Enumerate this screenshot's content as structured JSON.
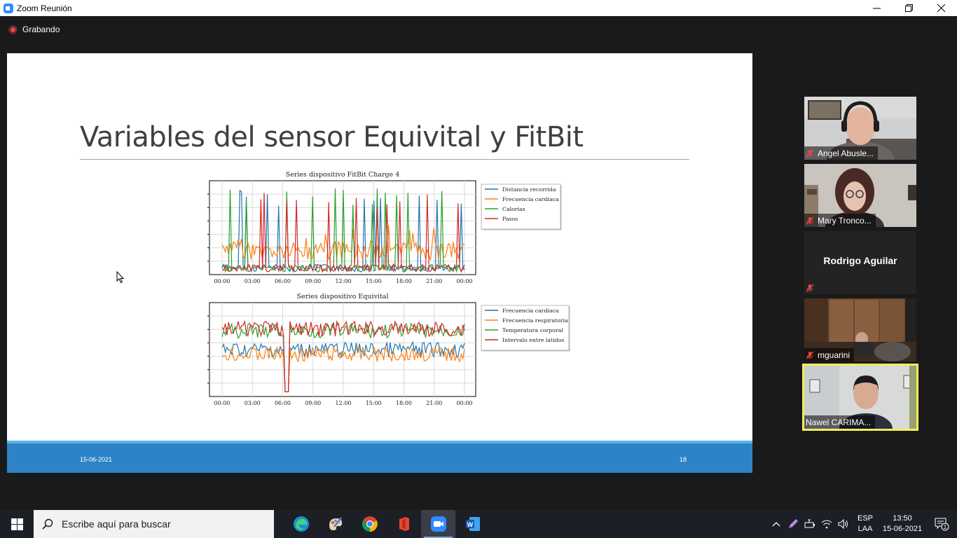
{
  "window": {
    "title": "Zoom Reunión",
    "controls": [
      "minimize",
      "restore",
      "close"
    ]
  },
  "recording": {
    "label": "Grabando"
  },
  "slide": {
    "title": "Variables del sensor Equivital y FitBit",
    "footer_date": "15-06-2021",
    "page_number": "18"
  },
  "participants": [
    {
      "name": "Angel Abusle...",
      "muted": true,
      "video": true
    },
    {
      "name": "Mary Tronco...",
      "muted": true,
      "video": true
    },
    {
      "name": "Rodrigo Aguilar",
      "muted": true,
      "video": false
    },
    {
      "name": "mguarini",
      "muted": true,
      "video": true
    },
    {
      "name": "Nawel CARIMA...",
      "muted": false,
      "video": true,
      "active_speaker": true
    }
  ],
  "taskbar": {
    "search_placeholder": "Escribe aquí para buscar",
    "apps": [
      "edge-icon",
      "paint-icon",
      "chrome-icon",
      "office-icon",
      "zoom-icon",
      "word-icon"
    ],
    "active_app": "zoom-icon",
    "lang_line1": "ESP",
    "lang_line2": "LAA",
    "time": "13:50",
    "date": "15-06-2021",
    "notifications": "1"
  },
  "chart_data": [
    {
      "type": "line",
      "title": "Series dispositivo FitBit Charge 4",
      "xticks": [
        "00:00",
        "03:00",
        "06:00",
        "09:00",
        "12:00",
        "15:00",
        "18:00",
        "21:00",
        "00:00"
      ],
      "legend_position": "outside-right-top",
      "grid": true,
      "series": [
        {
          "name": "Distancia recorrida",
          "color": "#1f77b4"
        },
        {
          "name": "Frecuencia cardíaca",
          "color": "#ff7f0e"
        },
        {
          "name": "Calorías",
          "color": "#2ca02c"
        },
        {
          "name": "Pasos",
          "color": "#d62728"
        }
      ]
    },
    {
      "type": "line",
      "title": "Series dispositivo Equivital",
      "xticks": [
        "00:00",
        "03:00",
        "06:00",
        "09:00",
        "12:00",
        "15:00",
        "18:00",
        "21:00",
        "00:00"
      ],
      "legend_position": "outside-right-top",
      "grid": true,
      "series": [
        {
          "name": "Frecuencia cardíaca",
          "color": "#1f77b4"
        },
        {
          "name": "Frecuencia respiratoria",
          "color": "#ff7f0e"
        },
        {
          "name": "Temperatura corporal",
          "color": "#2ca02c"
        },
        {
          "name": "Intervalo entre latidos",
          "color": "#d62728"
        }
      ]
    }
  ]
}
